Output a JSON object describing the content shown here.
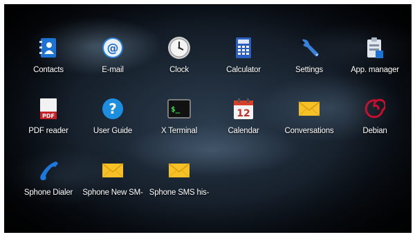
{
  "apps": [
    {
      "label": "Contacts",
      "icon": "contacts-icon"
    },
    {
      "label": "E-mail",
      "icon": "email-icon"
    },
    {
      "label": "Clock",
      "icon": "clock-icon"
    },
    {
      "label": "Calculator",
      "icon": "calculator-icon"
    },
    {
      "label": "Settings",
      "icon": "wrench-icon"
    },
    {
      "label": "App. manager",
      "icon": "clipboard-icon"
    },
    {
      "label": "PDF reader",
      "icon": "pdf-icon",
      "icon_text": "PDF"
    },
    {
      "label": "User Guide",
      "icon": "help-icon",
      "icon_text": "?"
    },
    {
      "label": "X Terminal",
      "icon": "terminal-icon",
      "icon_text": "$_"
    },
    {
      "label": "Calendar",
      "icon": "calendar-icon",
      "icon_text": "12"
    },
    {
      "label": "Conversations",
      "icon": "envelope-icon"
    },
    {
      "label": "Debian",
      "icon": "debian-swirl-icon"
    },
    {
      "label": "Sphone Dialer",
      "icon": "phone-handset-icon"
    },
    {
      "label": "Sphone New SM-",
      "icon": "envelope-icon"
    },
    {
      "label": "Sphone SMS his-",
      "icon": "envelope-icon"
    }
  ],
  "colors": {
    "label_text": "#ffffff",
    "background": "#0b1119",
    "accent_blue": "#1a73d0",
    "envelope": "#f6c027",
    "debian": "#c8102e"
  }
}
